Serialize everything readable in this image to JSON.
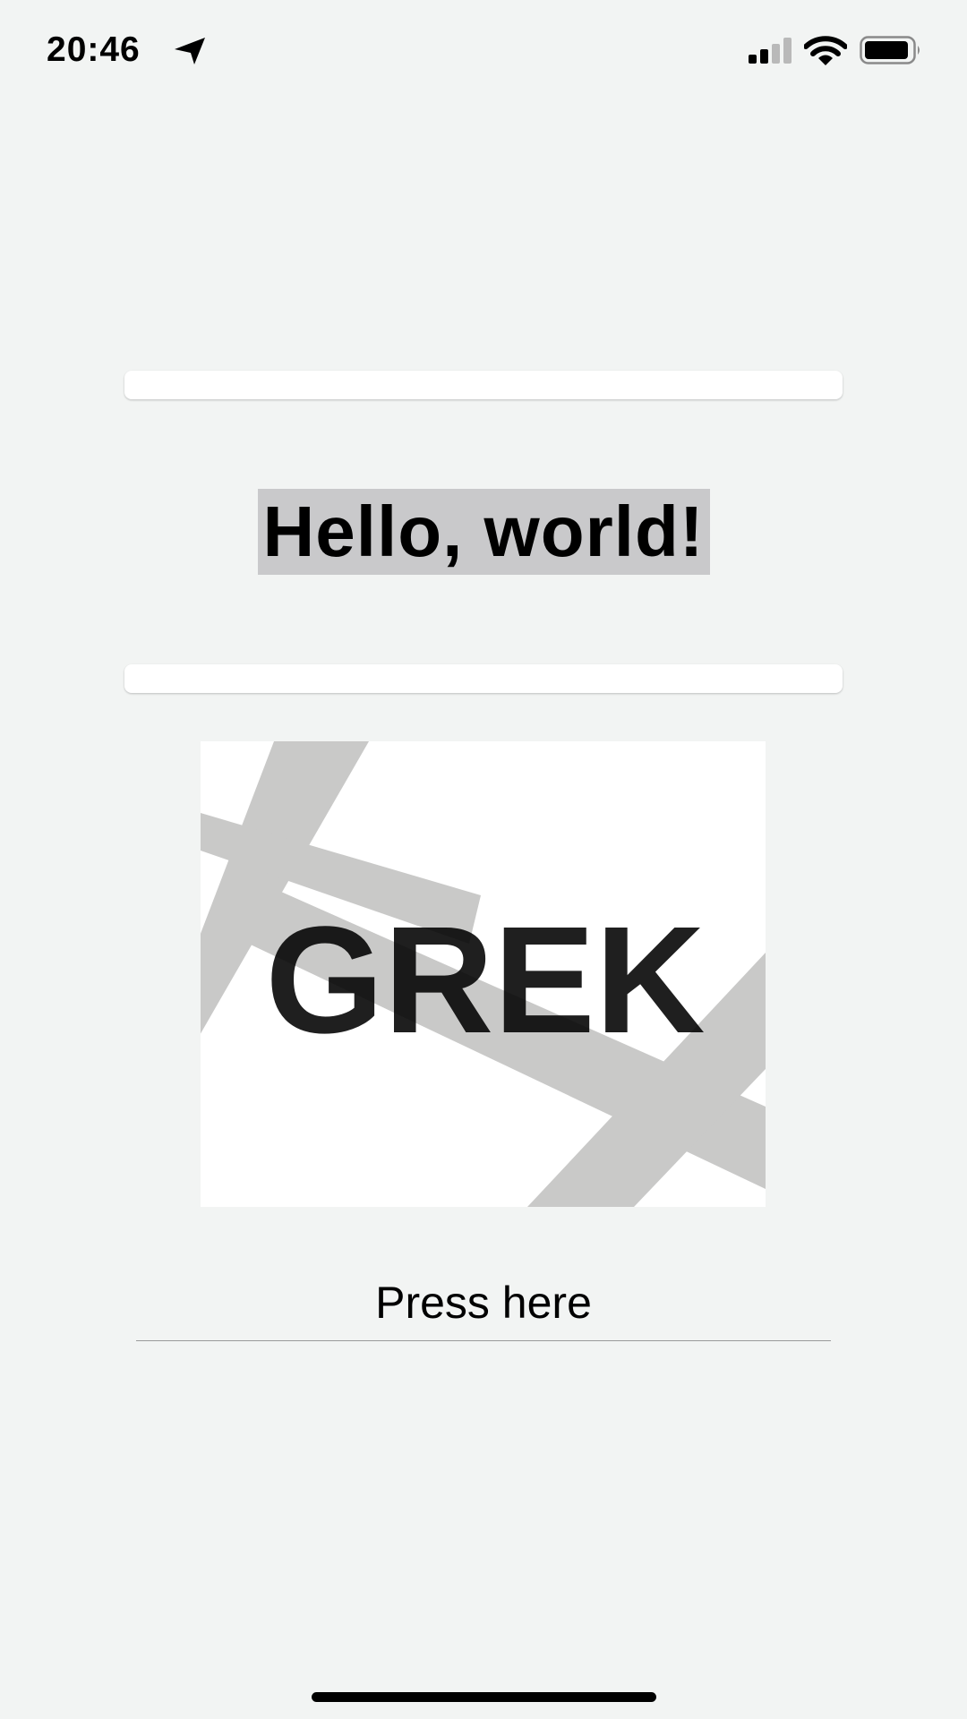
{
  "status_bar": {
    "time": "20:46",
    "icons": [
      "location-arrow-icon",
      "cellular-signal-icon",
      "wifi-icon",
      "battery-icon"
    ]
  },
  "form": {
    "top_field_value": "",
    "heading": "Hello, world!",
    "bottom_field_value": ""
  },
  "logo": {
    "text": "GREK"
  },
  "button": {
    "label": "Press here"
  },
  "colors": {
    "background": "#f2f4f3",
    "highlight": "#c9c9cb",
    "logo_stripes": "#c9c9c8"
  }
}
